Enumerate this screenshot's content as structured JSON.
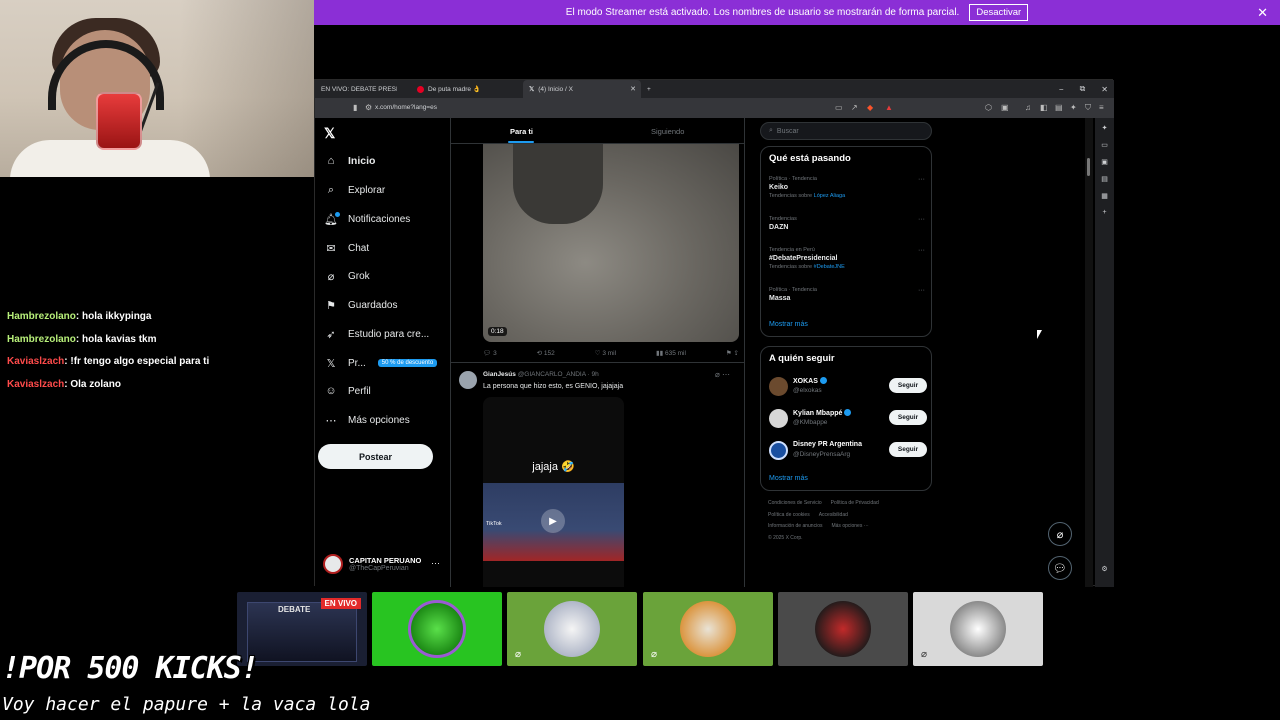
{
  "banner": {
    "text": "El modo Streamer está activado. Los nombres de usuario se mostrarán de forma parcial.",
    "button": "Desactivar",
    "close": "✕"
  },
  "chat": [
    {
      "user": "Hambrezolano",
      "text": ": hola ikkypinga",
      "color": "#b8f07a"
    },
    {
      "user": "Hambrezolano",
      "text": ": hola kavias tkm",
      "color": "#b8f07a"
    },
    {
      "user": "Kaviaslzach",
      "text": ": !fr tengo algo especial para ti",
      "color": "#ff4b4b"
    },
    {
      "user": "Kaviaslzach",
      "text": ": Ola zolano",
      "color": "#ff4b4b"
    }
  ],
  "browser": {
    "tabs": [
      {
        "label": "EN VIVO: DEBATE PRESIDENCIAL",
        "icon": "tv-icon"
      },
      {
        "label": "De puta madre 👌",
        "icon": "pinterest-icon"
      },
      {
        "label": "(4) Inicio / X",
        "icon": "x-icon"
      }
    ],
    "new_tab": "+",
    "url": "x.com/home?lang=es",
    "window_controls": [
      "−",
      "⧉",
      "✕"
    ]
  },
  "nav": {
    "items": [
      {
        "label": "Inicio",
        "icon": "home-icon"
      },
      {
        "label": "Explorar",
        "icon": "search-icon"
      },
      {
        "label": "Notificaciones",
        "icon": "bell-icon"
      },
      {
        "label": "Chat",
        "icon": "mail-icon"
      },
      {
        "label": "Grok",
        "icon": "grok-icon"
      },
      {
        "label": "Guardados",
        "icon": "bookmark-icon"
      },
      {
        "label": "Estudio para cre...",
        "icon": "rocket-icon"
      },
      {
        "label": "Pr...",
        "icon": "x-premium-icon"
      },
      {
        "label": "Perfil",
        "icon": "user-icon"
      },
      {
        "label": "Más opciones",
        "icon": "more-icon"
      }
    ],
    "promo": "50 % de descuento",
    "post_button": "Postear",
    "profile": {
      "name": "CAPITAN PERUANO",
      "handle": "@TheCapPeruvian",
      "more": "···"
    }
  },
  "feed": {
    "tab_active": "Para ti",
    "tab_other": "Siguiendo",
    "video_time": "0:18",
    "actions": [
      "3",
      "152",
      "3 mil",
      "635 mil"
    ],
    "tweet": {
      "name": "GianJesús",
      "handle": "@GIANCARLO_ANDIA · 9h",
      "text": "La persona que hizo esto, es GENIO, jajajaja",
      "media_caption": "jajaja 🤣",
      "tiktok": "TikTok"
    }
  },
  "sidebar": {
    "search_placeholder": "Buscar",
    "trends_title": "Qué está pasando",
    "trends": [
      {
        "context": "Política · Tendencia",
        "name": "Keiko",
        "sub": "Tendencias sobre ",
        "sub_link": "López Aliaga"
      },
      {
        "context": "Tendencias",
        "name": "DAZN",
        "sub": "",
        "sub_link": ""
      },
      {
        "context": "Tendencia en Perú",
        "name": "#DebatePresidencial",
        "sub": "Tendencias sobre ",
        "sub_link": "#DebateJNE"
      },
      {
        "context": "Política · Tendencia",
        "name": "Massa",
        "sub": "",
        "sub_link": ""
      }
    ],
    "show_more": "Mostrar más",
    "follow_title": "A quién seguir",
    "follow": [
      {
        "name": "XOKAS",
        "handle": "@elxokas",
        "button": "Seguir"
      },
      {
        "name": "Kylian Mbappé",
        "handle": "@KMbappe",
        "button": "Seguir"
      },
      {
        "name": "Disney PR Argentina",
        "handle": "@DisneyPrensaArg",
        "button": "Seguir"
      }
    ],
    "show_more_2": "Mostrar más",
    "footer": [
      "Condiciones de Servicio",
      "Política de Privacidad",
      "Política de cookies",
      "Accesibilidad",
      "Información de anuncios",
      "Más opciones ···",
      "© 2025 X Corp."
    ]
  },
  "tiles": {
    "live_badge": "EN VIVO",
    "live_brand": "DEBATE"
  },
  "overlay": {
    "goal": "!POR 500 KICKS!",
    "goal_sub": "Voy hacer el papure + la vaca lola"
  },
  "colors": {
    "banner": "#8b2fd6",
    "accent": "#1d9bf0",
    "live": "#e22a2a"
  }
}
